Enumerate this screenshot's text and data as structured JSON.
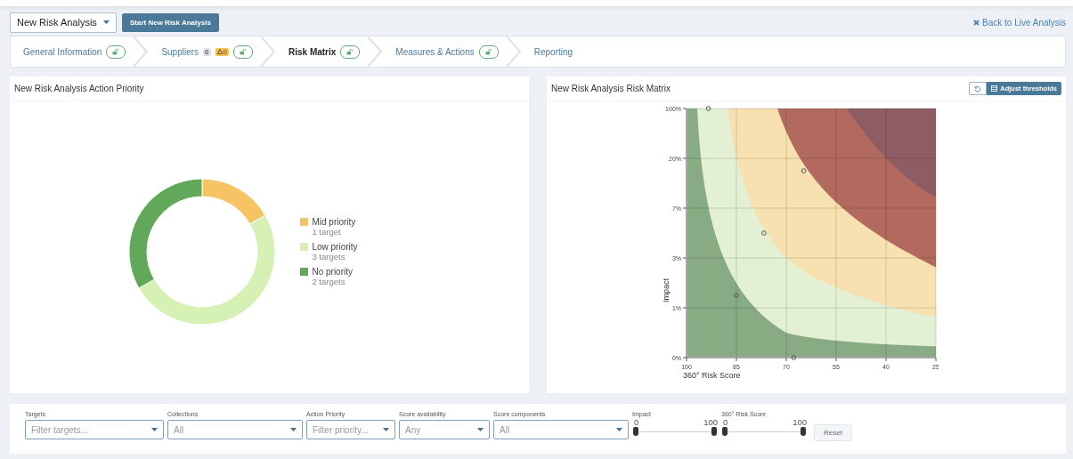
{
  "toolbar": {
    "analysis_select": {
      "value": "New Risk Analysis"
    },
    "start_button": "Start New Risk Analysis",
    "back_link": "Back to Live Analysis"
  },
  "steps": [
    {
      "label": "General Information",
      "selected": false,
      "lock_badge": true
    },
    {
      "label": "Suppliers",
      "selected": false,
      "lock_badge": true,
      "counts": [
        {
          "kind": "plain",
          "text": "6"
        },
        {
          "kind": "warning",
          "text": "0"
        }
      ]
    },
    {
      "label": "Risk Matrix",
      "selected": true,
      "lock_badge": true
    },
    {
      "label": "Measures & Actions",
      "selected": false,
      "lock_badge": true
    },
    {
      "label": "Reporting",
      "selected": false,
      "lock_badge": false
    }
  ],
  "priority_panel": {
    "title": "New Risk Analysis Action Priority",
    "legend": [
      {
        "count": "1 target",
        "color": "#f6c465"
      },
      {
        "count": "3 targets",
        "color": "#d5f2b4"
      },
      {
        "count": "2 targets",
        "color": "#62a85a"
      }
    ],
    "chart_data": {
      "type": "donut",
      "categories": [
        "Mid priority",
        "Low priority",
        "No priority"
      ],
      "values": [
        16.67,
        50,
        33.33
      ]
    }
  },
  "matrix_panel": {
    "title": "New Risk Analysis Risk Matrix",
    "adjust_button": "Adjust thresholds",
    "matrix": {
      "x_title": "360° Risk Score",
      "y_title": "Impact",
      "x_tick_labels": [
        "100",
        "85",
        "70",
        "55",
        "40",
        "25"
      ],
      "y_tick_labels": [
        "100%",
        "20%",
        "7%",
        "3%",
        "1%",
        "0%"
      ]
    }
  },
  "filters": [
    {
      "kind": "select",
      "label": "Targets",
      "placeholder": "Filter targets..."
    },
    {
      "kind": "select",
      "label": "Collections",
      "placeholder": "All"
    },
    {
      "kind": "select",
      "label": "Action Priority",
      "placeholder": "Filter priority..."
    },
    {
      "kind": "select",
      "label": "Score availability",
      "placeholder": "Any"
    },
    {
      "kind": "select",
      "label": "Score components",
      "placeholder": "All"
    },
    {
      "kind": "range",
      "label": "Impact",
      "min_label": "0",
      "max_label": "100",
      "thumbs": [
        {
          "level": 0
        },
        {
          "level": 1
        }
      ]
    },
    {
      "kind": "range",
      "label": "360° Risk Score",
      "min_label": "0",
      "max_label": "100",
      "thumbs": [
        {
          "level": 0
        },
        {
          "level": 1
        }
      ]
    }
  ],
  "reset_button": "Reset"
}
